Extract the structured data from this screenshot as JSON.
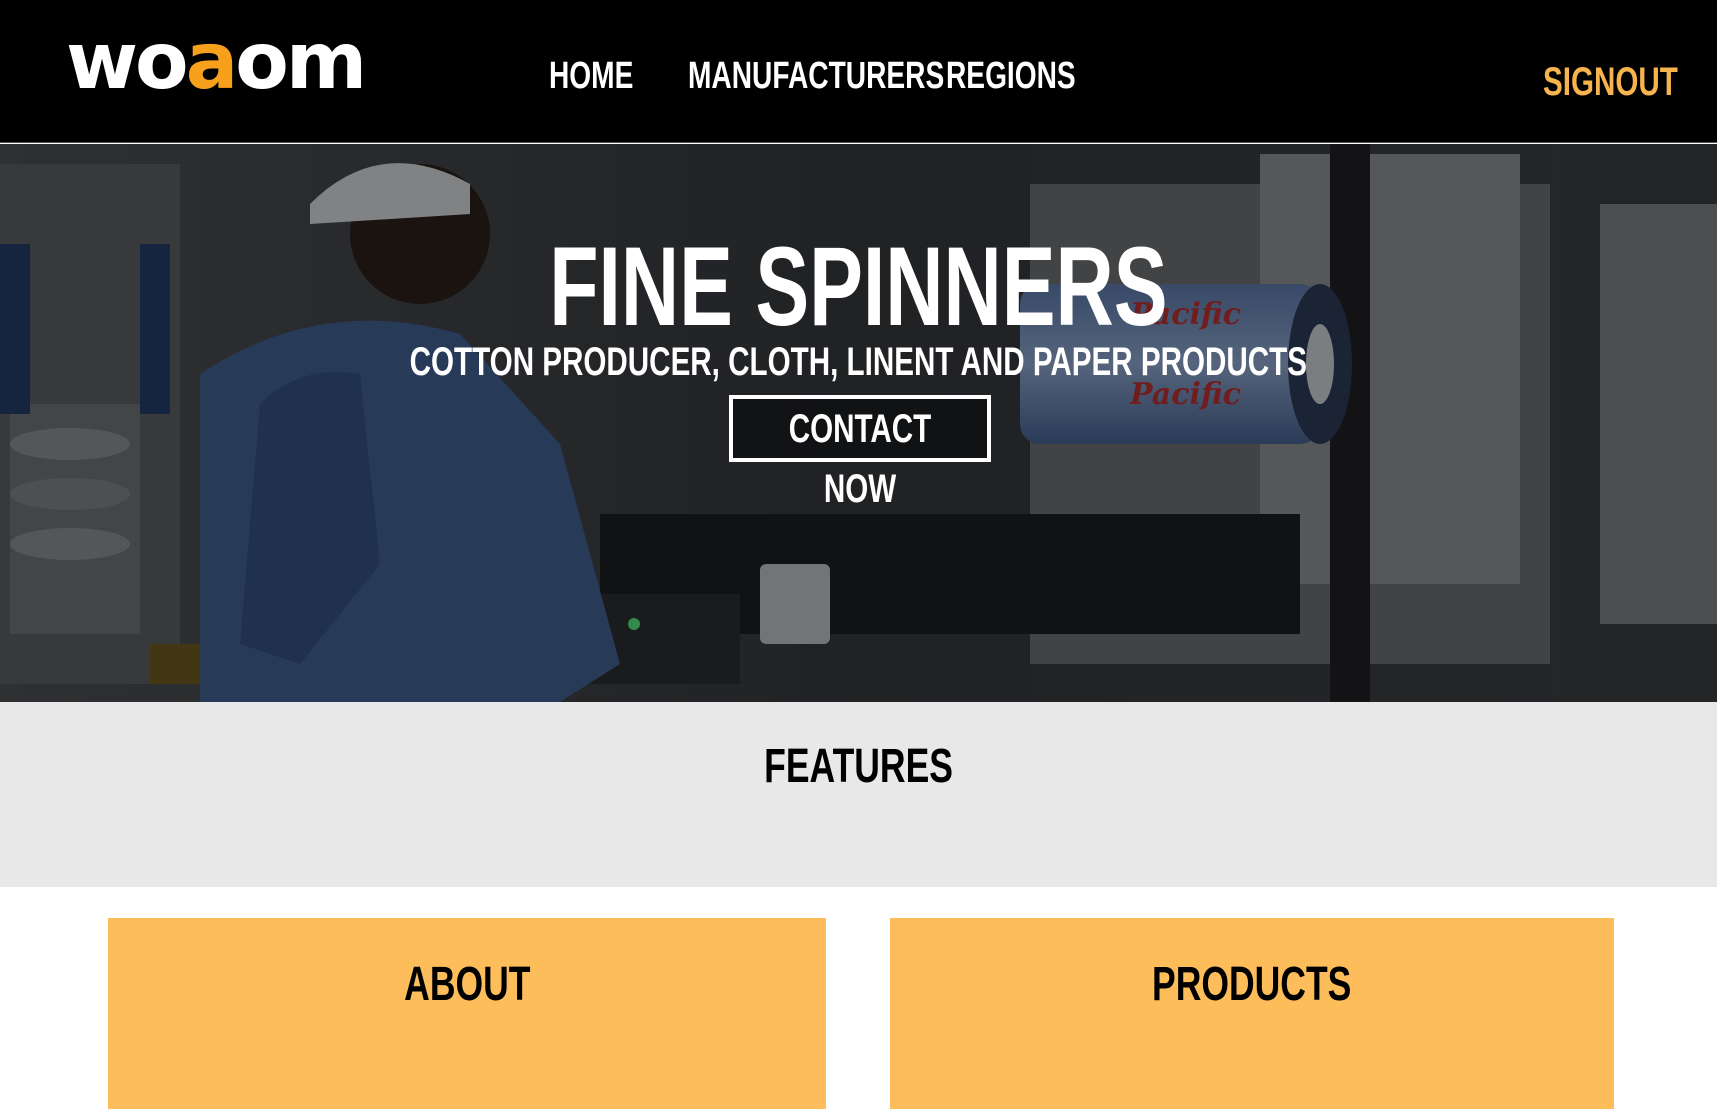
{
  "navbar": {
    "logo": {
      "part1": "wo",
      "accent": "a",
      "part2": "om"
    },
    "links": [
      {
        "label": "HOME"
      },
      {
        "label": "MANUFACTURERS"
      },
      {
        "label": "REGIONS"
      }
    ],
    "signout_label": "SIGNOUT"
  },
  "hero": {
    "title": "FINE SPINNERS",
    "subtitle": "COTTON PRODUCER, CLOTH, LINENT AND PAPER PRODUCTS",
    "cta_label": "CONTACT NOW",
    "image_label": "Pacific"
  },
  "features": {
    "title": "FEATURES"
  },
  "cards": [
    {
      "title": "ABOUT"
    },
    {
      "title": "PRODUCTS"
    }
  ],
  "colors": {
    "accent": "#f7a01c",
    "signout": "#f7b34d",
    "card": "#fdbd5a",
    "features_bg": "#e8e8e8"
  }
}
